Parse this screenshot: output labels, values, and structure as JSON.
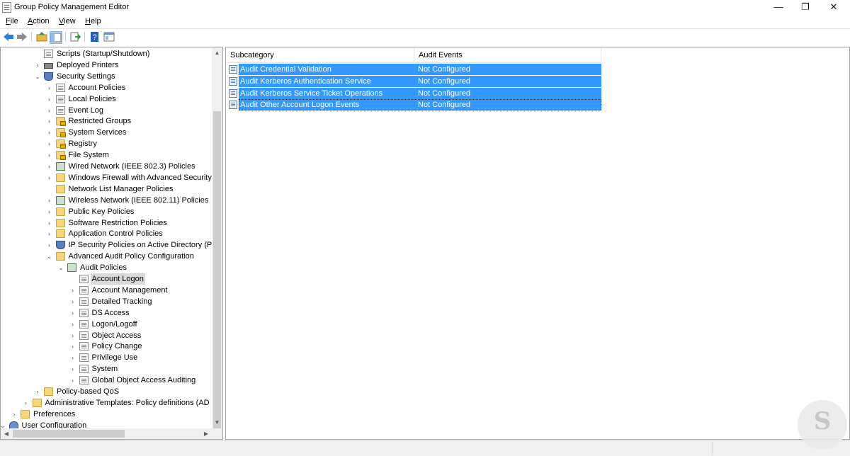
{
  "window": {
    "title": "Group Policy Management Editor",
    "minimize_glyph": "—",
    "restore_glyph": "❐",
    "close_glyph": "✕"
  },
  "menu": [
    {
      "label": "File",
      "key": "F",
      "rest": "ile"
    },
    {
      "label": "Action",
      "key": "A",
      "rest": "ction"
    },
    {
      "label": "View",
      "key": "V",
      "rest": "iew"
    },
    {
      "label": "Help",
      "key": "H",
      "rest": "elp"
    }
  ],
  "toolbar": {
    "icons": [
      "back-arrow-icon",
      "forward-arrow-icon",
      "up-folder-icon",
      "show-hide-tree-icon",
      "export-list-icon",
      "help-icon",
      "properties-icon"
    ],
    "colors": {
      "arrow": "#2f7fd8",
      "help": "#2a5bb8",
      "folder": "#e8b84a"
    }
  },
  "tree": {
    "items": [
      {
        "label": "Scripts (Startup/Shutdown)",
        "icon": "document-icon",
        "expander": ""
      },
      {
        "label": "Deployed Printers",
        "icon": "printer-icon",
        "expander": "›"
      },
      {
        "label": "Security Settings",
        "icon": "shield-icon",
        "expander": "⌄"
      },
      {
        "label": "Account Policies",
        "icon": "document-icon",
        "expander": "›"
      },
      {
        "label": "Local Policies",
        "icon": "document-icon",
        "expander": "›"
      },
      {
        "label": "Event Log",
        "icon": "document-icon",
        "expander": "›"
      },
      {
        "label": "Restricted Groups",
        "icon": "locked-folder-icon",
        "expander": "›"
      },
      {
        "label": "System Services",
        "icon": "locked-folder-icon",
        "expander": "›"
      },
      {
        "label": "Registry",
        "icon": "locked-folder-icon",
        "expander": "›"
      },
      {
        "label": "File System",
        "icon": "locked-folder-icon",
        "expander": "›"
      },
      {
        "label": "Wired Network (IEEE 802.3) Policies",
        "icon": "network-icon",
        "expander": "›"
      },
      {
        "label": "Windows Firewall with Advanced Security",
        "icon": "folder-icon",
        "expander": "›"
      },
      {
        "label": "Network List Manager Policies",
        "icon": "folder-icon",
        "expander": ""
      },
      {
        "label": "Wireless Network (IEEE 802.11) Policies",
        "icon": "network-icon",
        "expander": "›"
      },
      {
        "label": "Public Key Policies",
        "icon": "folder-icon",
        "expander": "›"
      },
      {
        "label": "Software Restriction Policies",
        "icon": "folder-icon",
        "expander": "›"
      },
      {
        "label": "Application Control Policies",
        "icon": "folder-icon",
        "expander": "›"
      },
      {
        "label": "IP Security Policies on Active Directory (P",
        "icon": "shield-icon",
        "expander": "›"
      },
      {
        "label": "Advanced Audit Policy Configuration",
        "icon": "folder-icon",
        "expander": "⌄"
      },
      {
        "label": "Audit Policies",
        "icon": "audit-policies-icon",
        "expander": "⌄"
      },
      {
        "label": "Account Logon",
        "icon": "document-icon",
        "expander": ""
      },
      {
        "label": "Account Management",
        "icon": "document-icon",
        "expander": "›"
      },
      {
        "label": "Detailed Tracking",
        "icon": "document-icon",
        "expander": "›"
      },
      {
        "label": "DS Access",
        "icon": "document-icon",
        "expander": "›"
      },
      {
        "label": "Logon/Logoff",
        "icon": "document-icon",
        "expander": "›"
      },
      {
        "label": "Object Access",
        "icon": "document-icon",
        "expander": "›"
      },
      {
        "label": "Policy Change",
        "icon": "document-icon",
        "expander": "›"
      },
      {
        "label": "Privilege Use",
        "icon": "document-icon",
        "expander": "›"
      },
      {
        "label": "System",
        "icon": "document-icon",
        "expander": "›"
      },
      {
        "label": "Global Object Access Auditing",
        "icon": "document-icon",
        "expander": "›"
      },
      {
        "label": "Policy-based QoS",
        "icon": "chart-folder-icon",
        "expander": "›"
      },
      {
        "label": "Administrative Templates: Policy definitions (AD",
        "icon": "folder-icon",
        "expander": "›"
      },
      {
        "label": "Preferences",
        "icon": "folder-icon",
        "expander": "›"
      },
      {
        "label": "User Configuration",
        "icon": "user-icon",
        "expander": "⌄"
      }
    ],
    "selected": "Account Logon",
    "scroll_up_glyph": "▲",
    "scroll_down_glyph": "▼",
    "scroll_left_glyph": "◀",
    "scroll_right_glyph": "▶"
  },
  "list": {
    "columns": [
      "Subcategory",
      "Audit Events"
    ],
    "rows": [
      {
        "subcategory": "Audit Credential Validation",
        "audit_events": "Not Configured"
      },
      {
        "subcategory": "Audit Kerberos Authentication Service",
        "audit_events": "Not Configured"
      },
      {
        "subcategory": "Audit Kerberos Service Ticket Operations",
        "audit_events": "Not Configured"
      },
      {
        "subcategory": "Audit Other Account Logon Events",
        "audit_events": "Not Configured"
      }
    ],
    "selection_color": "#3399ff"
  },
  "watermark": {
    "letter": "S"
  }
}
